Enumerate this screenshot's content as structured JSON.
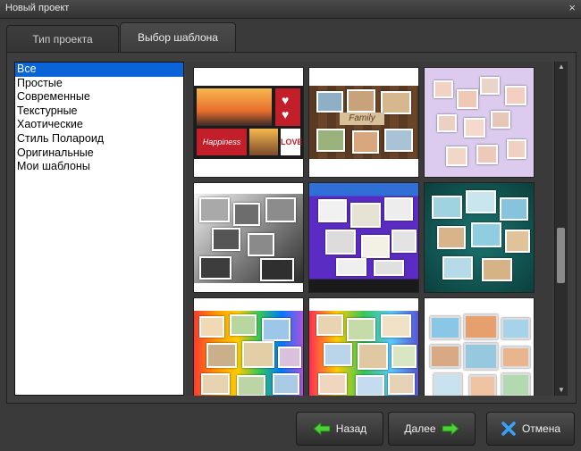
{
  "window": {
    "title": "Новый проект",
    "close_glyph": "×"
  },
  "tabs": [
    {
      "label": "Тип проекта",
      "active": false
    },
    {
      "label": "Выбор шаблона",
      "active": true
    }
  ],
  "categories": {
    "items": [
      "Все",
      "Простые",
      "Современные",
      "Текстурные",
      "Хаотические",
      "Стиль Полароид",
      "Оригинальные",
      "Мои шаблоны"
    ],
    "selected": "Все"
  },
  "templates": [
    {
      "theme": "sunset-love",
      "text": "Happiness",
      "text2": "LOVE",
      "colors": [
        "#f3a24a",
        "#c21f2a",
        "#1c1c1c"
      ]
    },
    {
      "theme": "family-wood",
      "text": "Family",
      "colors": [
        "#5a3a22",
        "#8b5a35",
        "#d8c19a"
      ]
    },
    {
      "theme": "baby-lilac",
      "colors": [
        "#d9c6ea",
        "#f2d6c8",
        "#e6e1f0"
      ]
    },
    {
      "theme": "black-white",
      "colors": [
        "#e6e6e6",
        "#5c5c5c",
        "#2a2a2a"
      ]
    },
    {
      "theme": "purple-flowers",
      "colors": [
        "#5b2cc4",
        "#1a1a1a",
        "#f5f5f5"
      ]
    },
    {
      "theme": "teal-beach",
      "colors": [
        "#0f5b58",
        "#9fd3e0",
        "#d9b48a"
      ]
    },
    {
      "theme": "rainbow-kids",
      "colors": [
        "#ff3b30",
        "#ffcc00",
        "#34c759",
        "#007aff",
        "#af52de"
      ]
    },
    {
      "theme": "rainbow-collage",
      "colors": [
        "#ff2d55",
        "#ffcc00",
        "#34c759",
        "#5856d6"
      ]
    },
    {
      "theme": "white-travel",
      "colors": [
        "#ffffff",
        "#8ac7e6",
        "#e5a06d"
      ]
    }
  ],
  "buttons": {
    "back": "Назад",
    "next": "Далее",
    "cancel": "Отмена"
  },
  "scroll": {
    "position_fraction": 0.55
  },
  "accent": "#0a64d8"
}
